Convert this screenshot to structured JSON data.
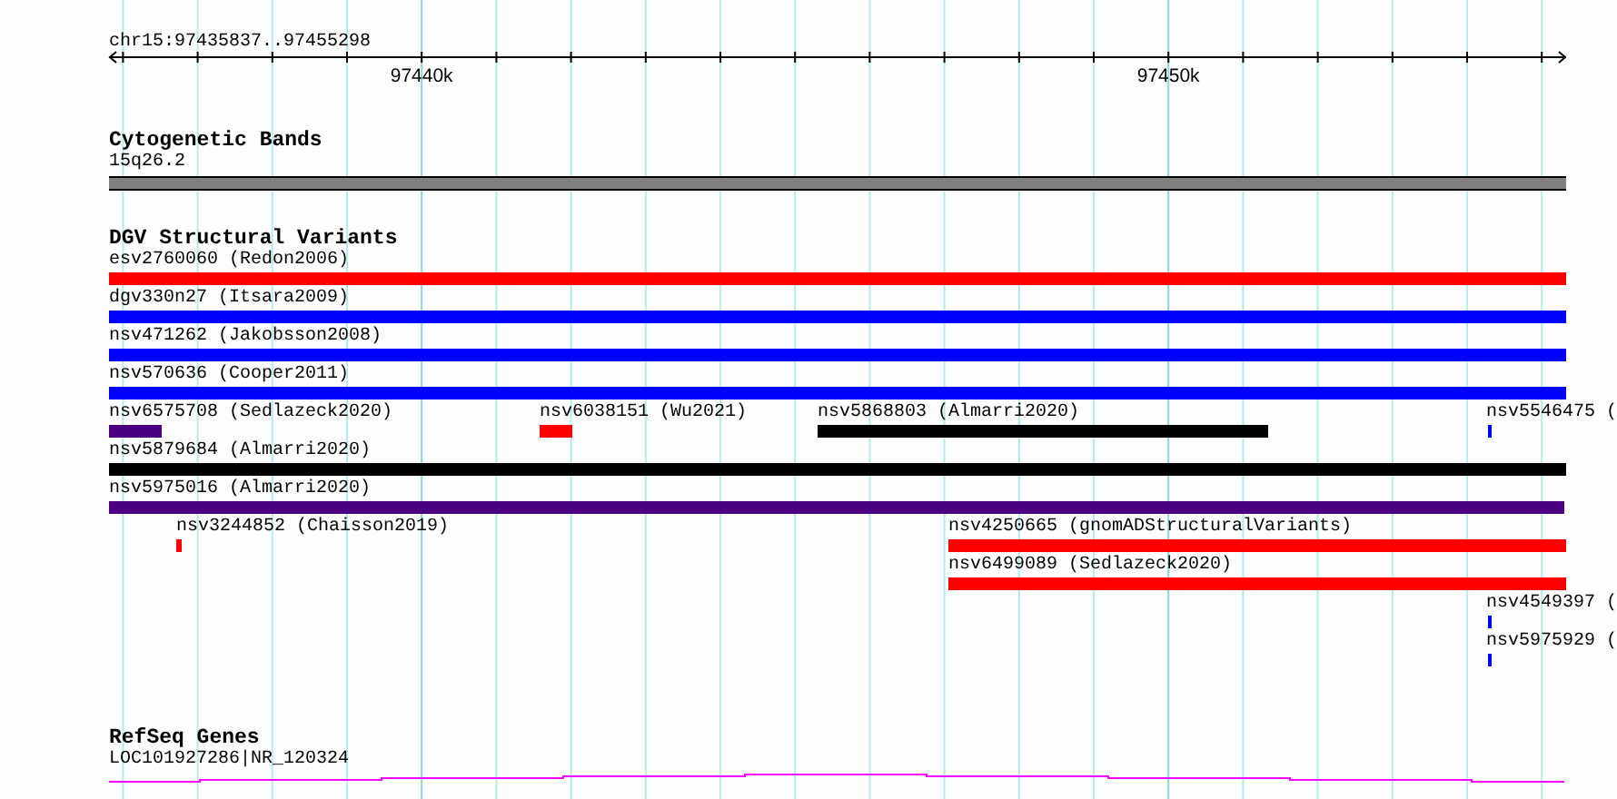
{
  "ruler": {
    "location": "chr15:97435837..97455298",
    "tick_labels": [
      "97440k",
      "97450k"
    ]
  },
  "tracks": [
    {
      "kind": "cytoband",
      "title": "Cytogenetic Bands",
      "features": [
        {
          "label": "15q26.2"
        }
      ]
    },
    {
      "kind": "variants",
      "title": "DGV Structural Variants",
      "rows": [
        [
          {
            "label": "esv2760060 (Redon2006)",
            "color": "#ff0000"
          }
        ],
        [
          {
            "label": "dgv330n27 (Itsara2009)",
            "color": "#0000ff"
          }
        ],
        [
          {
            "label": "nsv471262 (Jakobsson2008)",
            "color": "#0000ff"
          }
        ],
        [
          {
            "label": "nsv570636 (Cooper2011)",
            "color": "#0000ff"
          }
        ],
        [
          {
            "label": "nsv6575708 (Sedlazeck2020)",
            "color": "#4b0082"
          },
          {
            "label": "nsv6038151 (Wu2021)",
            "color": "#ff0000"
          },
          {
            "label": "nsv5868803 (Almarri2020)",
            "color": "#000000"
          },
          {
            "label": "nsv5546475 (",
            "color": "#0000ff"
          }
        ],
        [
          {
            "label": "nsv5879684 (Almarri2020)",
            "color": "#000000"
          }
        ],
        [
          {
            "label": "nsv5975016 (Almarri2020)",
            "color": "#4b0082"
          }
        ],
        [
          {
            "label": "nsv3244852 (Chaisson2019)",
            "color": "#ff0000"
          },
          {
            "label": "nsv4250665 (gnomADStructuralVariants)",
            "color": "#ff0000"
          }
        ],
        [
          {
            "label": "nsv6499089 (Sedlazeck2020)",
            "color": "#ff0000"
          }
        ],
        [
          {
            "label": "nsv4549397 (",
            "color": "#0000ff"
          }
        ],
        [
          {
            "label": "nsv5975929 (",
            "color": "#0000ff"
          }
        ]
      ]
    },
    {
      "kind": "gene",
      "title": "RefSeq Genes",
      "features": [
        {
          "label": "LOC101927286|NR_120324"
        }
      ]
    }
  ]
}
